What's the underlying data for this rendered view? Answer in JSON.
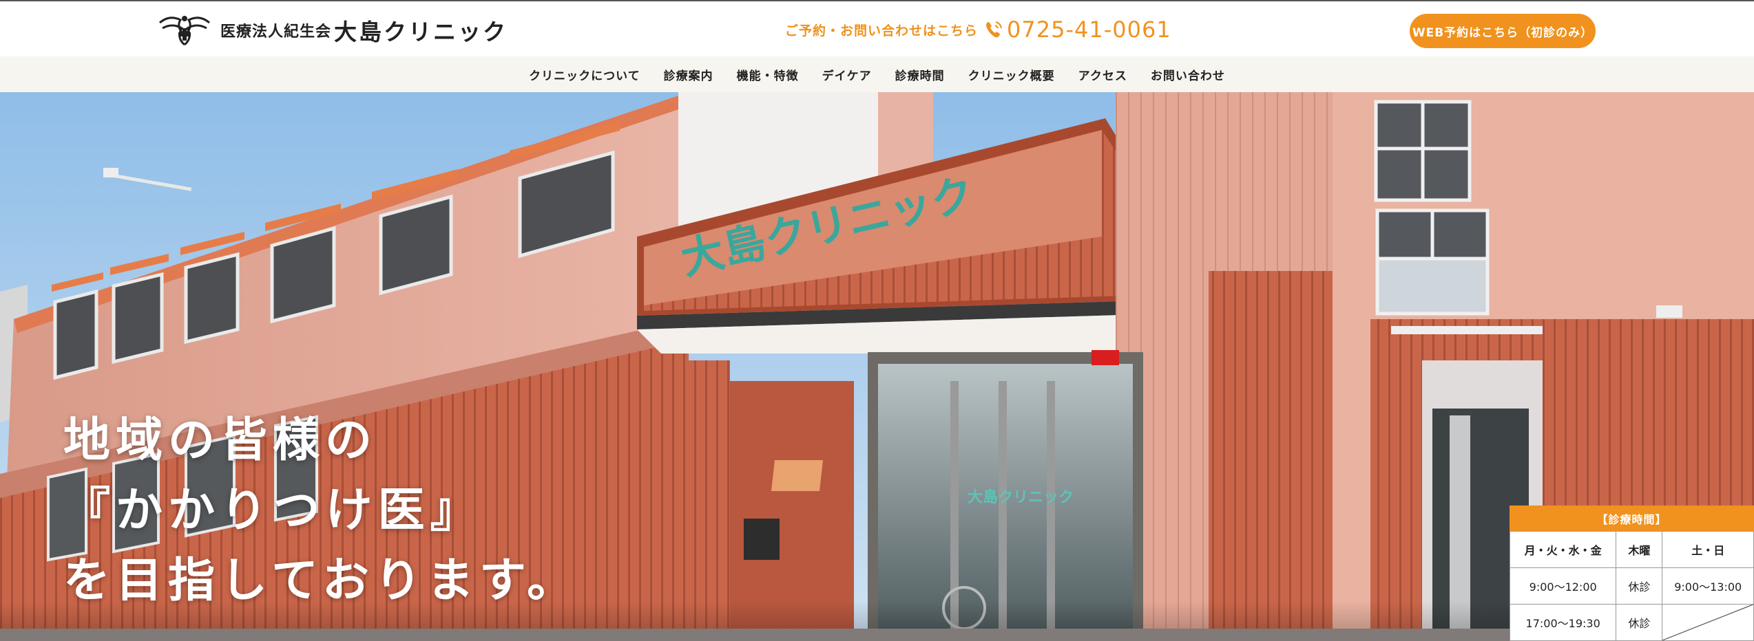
{
  "header": {
    "logo_small": "医療法人紀生会",
    "logo_big": "大島クリニック",
    "contact_label": "ご予約・お問い合わせはこちら",
    "phone": "0725-41-0061",
    "web_button": "WEB予約はこちら（初診のみ）"
  },
  "nav": {
    "items": [
      {
        "label": "クリニックについて"
      },
      {
        "label": "診療案内"
      },
      {
        "label": "機能・特徴"
      },
      {
        "label": "デイケア"
      },
      {
        "label": "診療時間"
      },
      {
        "label": "クリニック概要"
      },
      {
        "label": "アクセス"
      },
      {
        "label": "お問い合わせ"
      }
    ]
  },
  "hero": {
    "line1": "地域の皆様の",
    "line2": "『かかりつけ医』",
    "line3": "を目指しております。",
    "sign_text": "大島クリニック",
    "door_text": "大島クリニック"
  },
  "hours": {
    "title": "【診療時間】",
    "headers": [
      "月・火・水・金",
      "木曜",
      "土・日"
    ],
    "rows": [
      [
        "9:00〜12:00",
        "休診",
        "9:00〜13:00"
      ],
      [
        "17:00〜19:30",
        "休診",
        ""
      ]
    ]
  },
  "colors": {
    "accent": "#f0921d",
    "nav_bg": "#f7f5f0"
  }
}
